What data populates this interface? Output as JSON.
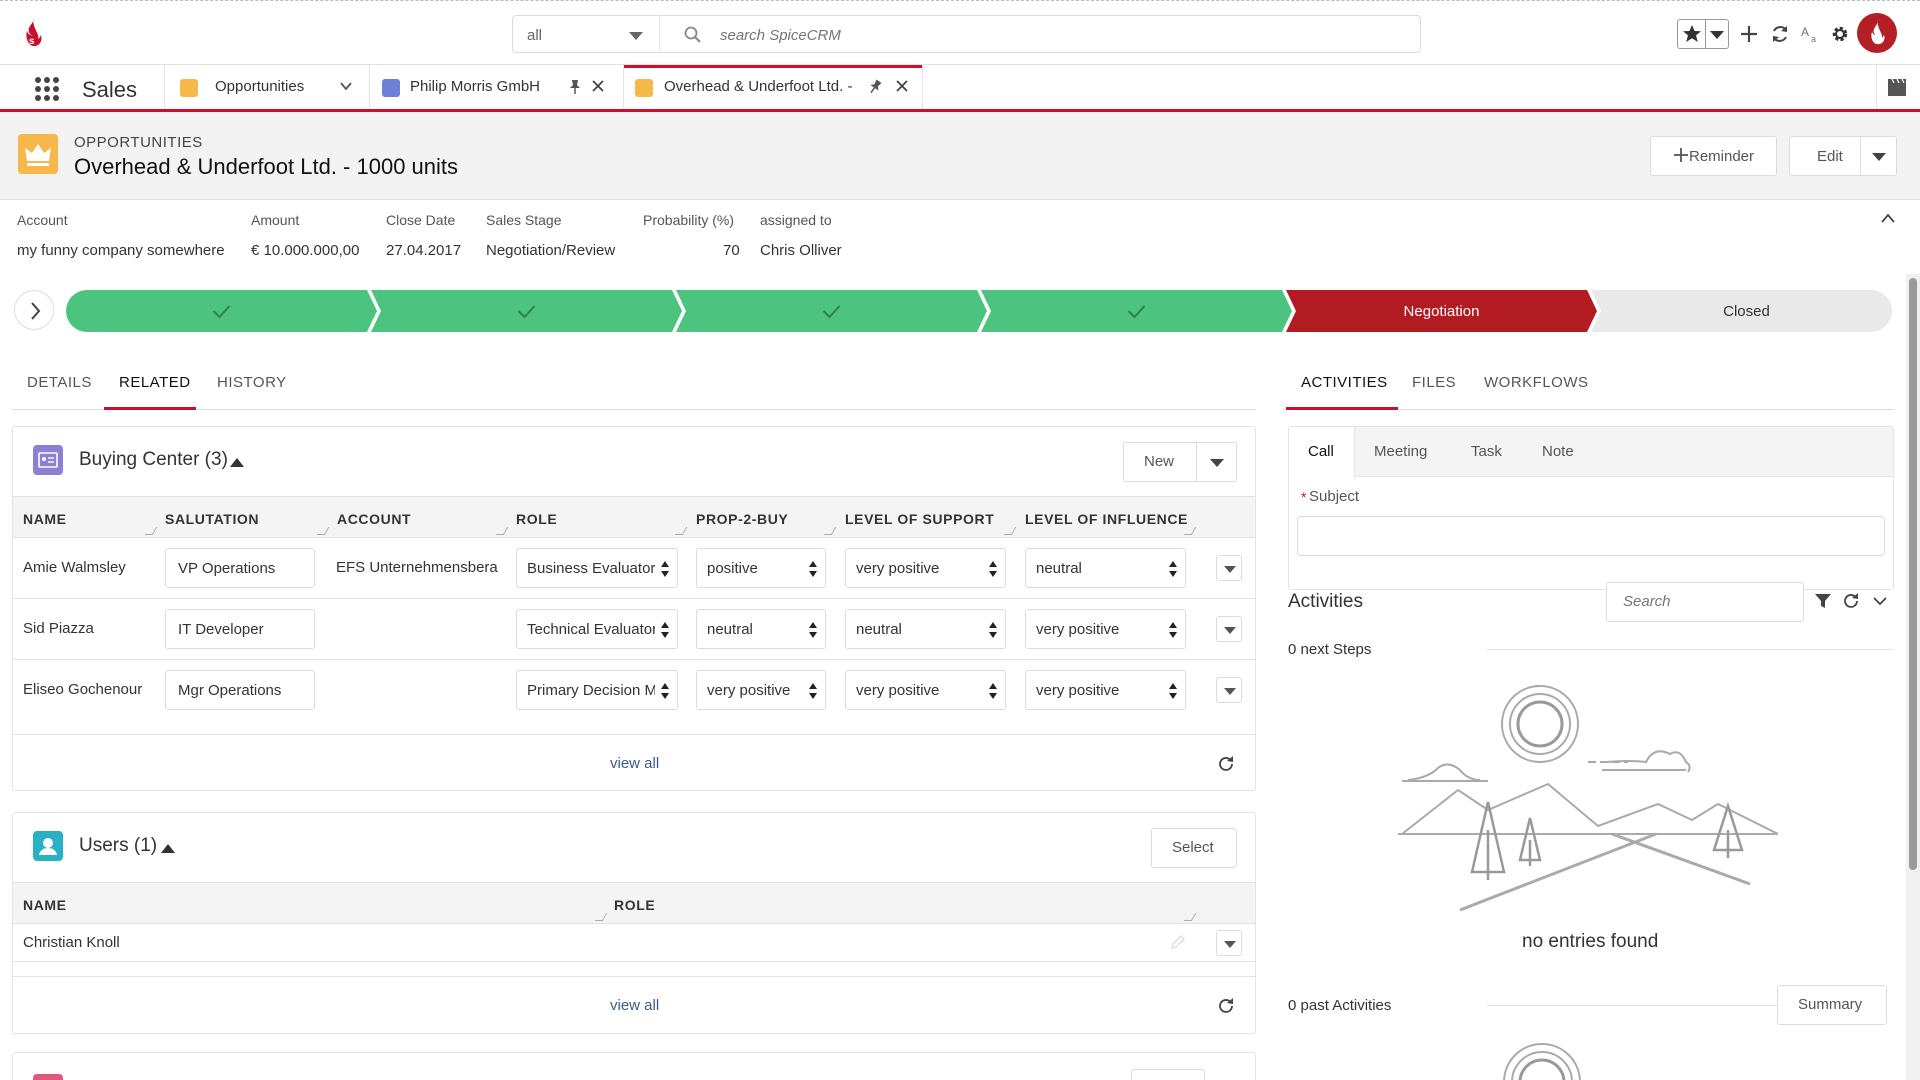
{
  "topbar": {
    "search_scope": "all",
    "search_placeholder": "search SpiceCRM"
  },
  "navbar": {
    "app_name": "Sales",
    "tabs": [
      {
        "label": "Opportunities"
      },
      {
        "label": "Philip Morris GmbH"
      },
      {
        "label": "Overhead & Underfoot Ltd. -"
      }
    ]
  },
  "header": {
    "module": "OPPORTUNITIES",
    "title": "Overhead & Underfoot Ltd. - 1000 units",
    "reminder_label": "Reminder",
    "edit_label": "Edit"
  },
  "summary": {
    "fields": [
      {
        "label": "Account",
        "value": "my funny company somewhere"
      },
      {
        "label": "Amount",
        "value": "€ 10.000.000,00"
      },
      {
        "label": "Close Date",
        "value": "27.04.2017"
      },
      {
        "label": "Sales Stage",
        "value": "Negotiation/Review"
      },
      {
        "label": "Probability (%)",
        "value": "70"
      },
      {
        "label": "assigned to",
        "value": "Chris Olliver"
      }
    ]
  },
  "path": {
    "stages": [
      {
        "label": "",
        "state": "done"
      },
      {
        "label": "",
        "state": "done"
      },
      {
        "label": "",
        "state": "done"
      },
      {
        "label": "",
        "state": "done"
      },
      {
        "label": "Negotiation",
        "state": "current"
      },
      {
        "label": "Closed",
        "state": "todo"
      }
    ],
    "colors": {
      "done": "#4cc47f",
      "current": "#b31b23",
      "todo": "#e9e9e9"
    }
  },
  "left_tabs": {
    "details": "DETAILS",
    "related": "RELATED",
    "history": "HISTORY"
  },
  "buying_center": {
    "title": "Buying Center (3)",
    "new_label": "New",
    "columns": [
      "NAME",
      "SALUTATION",
      "ACCOUNT",
      "ROLE",
      "PROP-2-BUY",
      "LEVEL OF SUPPORT",
      "LEVEL OF INFLUENCE"
    ],
    "rows": [
      {
        "name": "Amie Walmsley",
        "salutation": "VP Operations",
        "account": "EFS Unternehmensberatung",
        "role": "Business Evaluator",
        "prop": "positive",
        "support": "very positive",
        "influence": "neutral"
      },
      {
        "name": "Sid Piazza",
        "salutation": "IT Developer",
        "account": "",
        "role": "Technical Evaluator",
        "prop": "neutral",
        "support": "neutral",
        "influence": "very positive"
      },
      {
        "name": "Eliseo Gochenour",
        "salutation": "Mgr Operations",
        "account": "",
        "role": "Primary Decision Maker",
        "prop": "very positive",
        "support": "very positive",
        "influence": "very positive"
      }
    ],
    "view_all": "view all"
  },
  "users_panel": {
    "title": "Users (1)",
    "select_label": "Select",
    "columns": [
      "NAME",
      "ROLE"
    ],
    "rows": [
      {
        "name": "Christian Knoll",
        "role": ""
      }
    ],
    "view_all": "view all"
  },
  "right_tabs": {
    "activities": "ACTIVITIES",
    "files": "FILES",
    "workflows": "WORKFLOWS"
  },
  "composer": {
    "tabs": [
      "Call",
      "Meeting",
      "Task",
      "Note"
    ],
    "subject_label": "Subject",
    "required_mark": "*"
  },
  "activities": {
    "title": "Activities",
    "search_placeholder": "Search",
    "next_steps": "0 next Steps",
    "empty_text": "no entries found",
    "past": "0 past Activities",
    "summary_label": "Summary"
  },
  "colors": {
    "accent_red": "#c8102e",
    "opportunity_orange": "#f6b84a",
    "contact_purple": "#8e7fd6",
    "user_teal": "#2ab0c5"
  }
}
